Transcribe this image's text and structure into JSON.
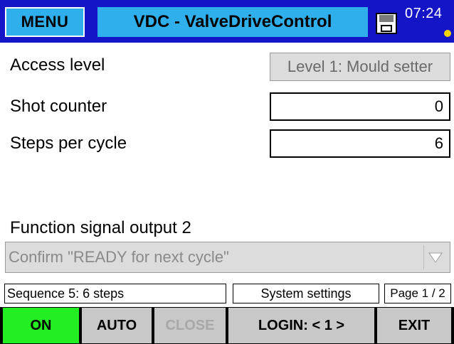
{
  "header": {
    "menu_label": "MENU",
    "title": "VDC - ValveDriveControl",
    "clock": "07:24",
    "status_dot_color": "#f2d400"
  },
  "form": {
    "access_level": {
      "label": "Access level",
      "value": "Level 1: Mould setter"
    },
    "shot_counter": {
      "label": "Shot counter",
      "value": "0"
    },
    "steps_per_cycle": {
      "label": "Steps per cycle",
      "value": "6"
    },
    "function_signal": {
      "label": "Function signal output 2",
      "value": "Confirm \"READY for next cycle\""
    }
  },
  "statusbar": {
    "sequence": "Sequence 5: 6 steps",
    "section": "System settings",
    "page": "Page 1 / 2"
  },
  "buttons": {
    "on": "ON",
    "auto": "AUTO",
    "close": "CLOSE",
    "login": "LOGIN:  < 1 >",
    "exit": "EXIT"
  },
  "colors": {
    "header_bg": "#1515c8",
    "accent": "#2fb0ec",
    "on_green": "#22ee22",
    "button_gray": "#c8c8c8"
  },
  "icons": {
    "save": "floppy-disk-icon",
    "dropdown": "triangle-down-icon"
  }
}
